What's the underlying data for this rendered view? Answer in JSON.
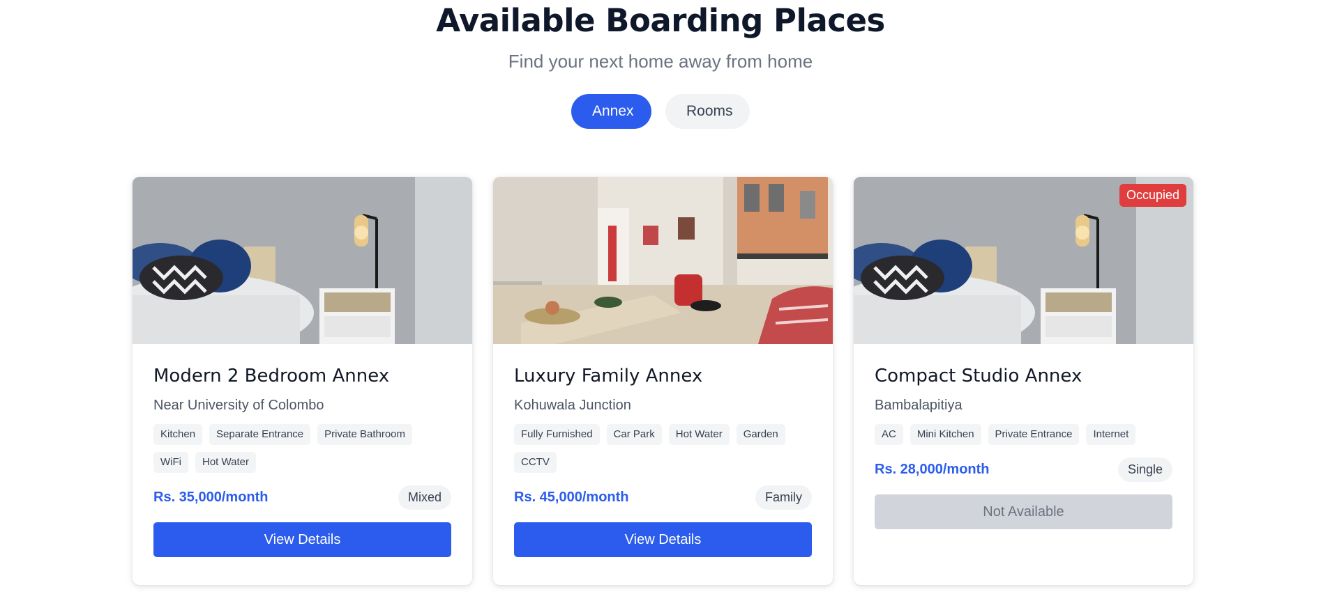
{
  "header": {
    "title": "Available Boarding Places",
    "subtitle": "Find your next home away from home"
  },
  "filters": {
    "annex_label": "Annex",
    "rooms_label": "Rooms",
    "active": "Annex"
  },
  "colors": {
    "accent": "#2b5ced",
    "occupied": "#e03e3e",
    "disabled": "#d1d5db"
  },
  "listings": [
    {
      "title": "Modern 2 Bedroom Annex",
      "location": "Near University of Colombo",
      "tags": [
        "Kitchen",
        "Separate Entrance",
        "Private Bathroom",
        "WiFi",
        "Hot Water"
      ],
      "price": "Rs. 35,000/month",
      "type": "Mixed",
      "button": "View Details",
      "image": "bedroom-photo"
    },
    {
      "title": "Luxury Family Annex",
      "location": "Kohuwala Junction",
      "tags": [
        "Fully Furnished",
        "Car Park",
        "Hot Water",
        "Garden",
        "CCTV"
      ],
      "price": "Rs. 45,000/month",
      "type": "Family",
      "button": "View Details",
      "image": "living-room-photo"
    },
    {
      "title": "Compact Studio Annex",
      "location": "Bambalapitiya",
      "tags": [
        "AC",
        "Mini Kitchen",
        "Private Entrance",
        "Internet"
      ],
      "price": "Rs. 28,000/month",
      "type": "Single",
      "button": "Not Available",
      "status": "Occupied",
      "image": "bedroom-photo"
    }
  ]
}
